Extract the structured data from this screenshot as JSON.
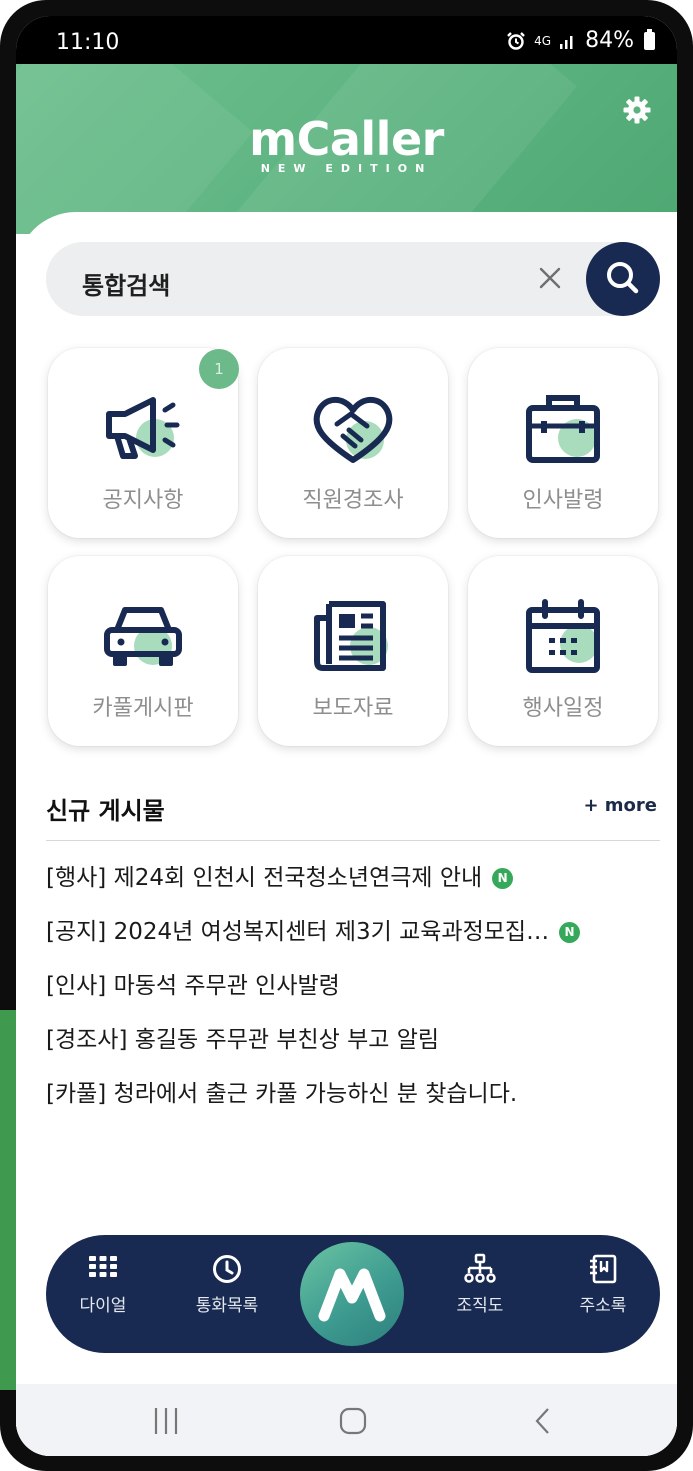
{
  "status_bar": {
    "time": "11:10",
    "network": "4G",
    "battery": "84%",
    "icons": [
      "alarm-icon",
      "signal-icon",
      "battery-icon"
    ]
  },
  "header": {
    "app_name": "mCaller",
    "app_subtitle": "NEW EDITION",
    "settings_icon": "gear-icon",
    "accent_color": "#5cb380"
  },
  "search": {
    "label": "통합검색",
    "clear_icon": "close-icon",
    "button_icon": "search-icon"
  },
  "tiles": [
    {
      "label": "공지사항",
      "icon": "megaphone-icon",
      "badge": "1"
    },
    {
      "label": "직원경조사",
      "icon": "handshake-heart-icon"
    },
    {
      "label": "인사발령",
      "icon": "briefcase-icon"
    },
    {
      "label": "카풀게시판",
      "icon": "car-icon"
    },
    {
      "label": "보도자료",
      "icon": "newspaper-icon"
    },
    {
      "label": "행사일정",
      "icon": "calendar-icon"
    }
  ],
  "new_posts": {
    "title": "신규 게시물",
    "more_label": "+ more",
    "items": [
      {
        "text": "[행사] 제24회 인천시 전국청소년연극제 안내",
        "badge": "N"
      },
      {
        "text": "[공지] 2024년 여성복지센터 제3기 교육과정모집…",
        "badge": "N"
      },
      {
        "text": "[인사] 마동석 주무관 인사발령"
      },
      {
        "text": "[경조사] 홍길동 주무관 부친상 부고 알림"
      },
      {
        "text": "[카풀] 청라에서 출근 카풀 가능하신 분 찾습니다."
      }
    ]
  },
  "bottom_nav": {
    "items": [
      {
        "label": "다이얼",
        "icon": "dialpad-icon"
      },
      {
        "label": "통화목록",
        "icon": "clock-icon"
      },
      {
        "label": "조직도",
        "icon": "org-chart-icon"
      },
      {
        "label": "주소록",
        "icon": "address-book-icon"
      }
    ],
    "center_icon": "mcaller-logo-icon",
    "colors": {
      "bar": "#182a51",
      "center": "#3e9c91"
    }
  },
  "system_nav": {
    "icons": [
      "recent-apps-icon",
      "home-icon",
      "back-icon"
    ]
  }
}
